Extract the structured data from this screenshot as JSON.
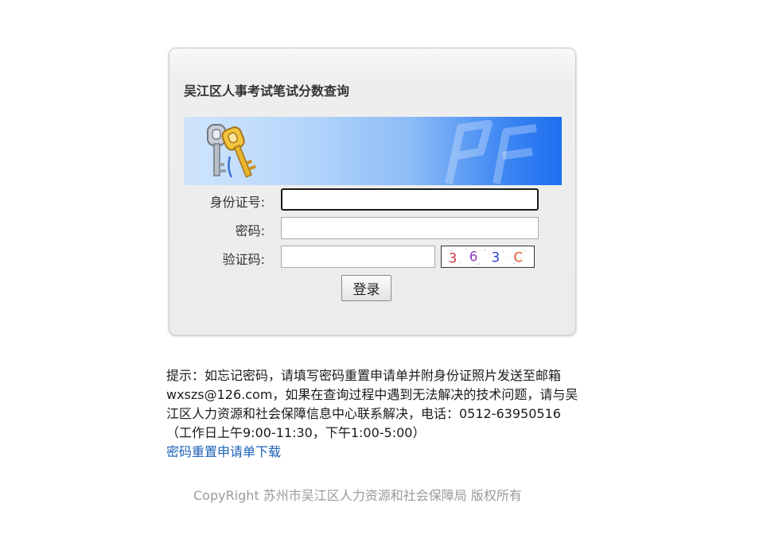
{
  "login": {
    "title": "吴江区人事考试笔试分数查询",
    "id_label": "身份证号:",
    "id_value": "",
    "password_label": "密码:",
    "password_value": "",
    "captcha_label": "验证码:",
    "captcha_value": "",
    "captcha_text": "3 6 3 C",
    "submit_label": "登录"
  },
  "notice": {
    "text": "提示：如忘记密码，请填写密码重置申请单并附身份证照片发送至邮箱wxszs@126.com，如果在查询过程中遇到无法解决的技术问题，请与吴江区人力资源和社会保障信息中心联系解决，电话：0512-63950516（工作日上午9:00-11:30，下午1:00-5:00）",
    "download_link": "密码重置申请单下载"
  },
  "footer": {
    "copyright": "CopyRight 苏州市吴江区人力资源和社会保障局 版权所有"
  },
  "colors": {
    "link": "#1c62b8",
    "banner_end": "#1d6ff0",
    "footer_text": "#9a9a9a"
  },
  "icons": {
    "banner_icon": "keys-icon",
    "banner_watermark": "logo-watermark"
  }
}
